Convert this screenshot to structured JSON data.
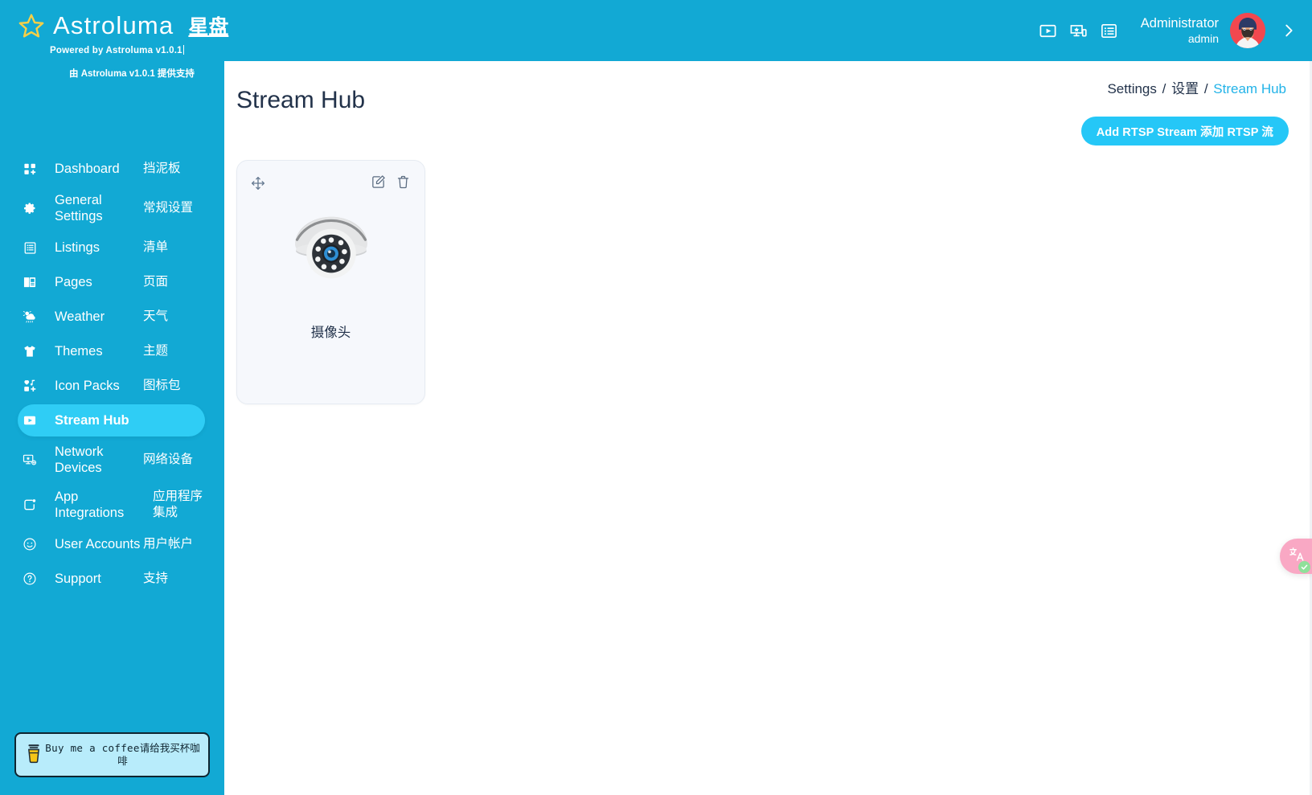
{
  "brand": {
    "name": "Astroluma",
    "name_cn": "星盘",
    "powered": "Powered by Astroluma v1.0.1",
    "powered_cn": "由 Astroluma v1.0.1 提供支持",
    "logo_icon": "star-icon"
  },
  "header": {
    "icons": [
      {
        "name": "video-player-icon",
        "glyph": "play-in-box"
      },
      {
        "name": "device-cast-icon",
        "glyph": "screen-share"
      },
      {
        "name": "list-view-icon",
        "glyph": "list"
      }
    ],
    "user_name": "Administrator",
    "user_role": "admin",
    "avatar_icon": "user-avatar",
    "expand_icon": "chevron-right-icon"
  },
  "sidebar": {
    "items": [
      {
        "label": "Dashboard",
        "label_cn": "挡泥板",
        "icon": "grid-dashboard-icon",
        "active": false
      },
      {
        "label": "General Settings",
        "label_cn": "常规设置",
        "icon": "gear-icon",
        "active": false
      },
      {
        "label": "Listings",
        "label_cn": "清单",
        "icon": "listings-icon",
        "active": false
      },
      {
        "label": "Pages",
        "label_cn": "页面",
        "icon": "book-pages-icon",
        "active": false
      },
      {
        "label": "Weather",
        "label_cn": "天气",
        "icon": "cloud-weather-icon",
        "active": false
      },
      {
        "label": "Themes",
        "label_cn": "主题",
        "icon": "tshirt-themes-icon",
        "active": false
      },
      {
        "label": "Icon Packs",
        "label_cn": "图标包",
        "icon": "icon-packs-icon",
        "active": false
      },
      {
        "label": "Stream Hub",
        "label_cn": "",
        "icon": "stream-play-icon",
        "active": true
      },
      {
        "label": "Network Devices",
        "label_cn": "网络设备",
        "icon": "network-device-icon",
        "active": false
      },
      {
        "label": "App Integrations",
        "label_cn": "应用程序集成",
        "icon": "app-integration-icon",
        "active": false
      },
      {
        "label": "User Accounts",
        "label_cn": "用户帐户",
        "icon": "user-circle-icon",
        "active": false
      },
      {
        "label": "Support",
        "label_cn": "支持",
        "icon": "help-question-icon",
        "active": false
      }
    ],
    "coffee": {
      "label": "Buy me a coffee",
      "label_cn": "请给我买杯咖啡",
      "icon": "coffee-cup-icon"
    }
  },
  "main": {
    "title": "Stream Hub",
    "breadcrumb": {
      "first": "Settings",
      "sep1": "/",
      "second": "设置",
      "sep2": "/",
      "current": "Stream Hub"
    },
    "add_button": "Add RTSP Stream 添加 RTSP 流",
    "streams": [
      {
        "name": "摄像头",
        "thumbnail_icon": "dome-security-camera-icon",
        "move_icon": "move-arrows-icon",
        "edit_icon": "edit-pencil-icon",
        "delete_icon": "trash-icon"
      }
    ]
  },
  "translate_widget": {
    "icon": "translate-icon",
    "status_icon": "check-circle-icon"
  },
  "colors": {
    "brand_blue": "#12a9d4",
    "accent_cyan": "#25c7f7",
    "active_nav": "#2fcdf5",
    "card_bg": "#f6f8fc",
    "text_dark": "#22324a",
    "link_blue": "#22b3e8",
    "coffee_bg": "#b8ecfb",
    "translate_pink": "#f9a8c4",
    "translate_check_green": "#8fe09a"
  }
}
